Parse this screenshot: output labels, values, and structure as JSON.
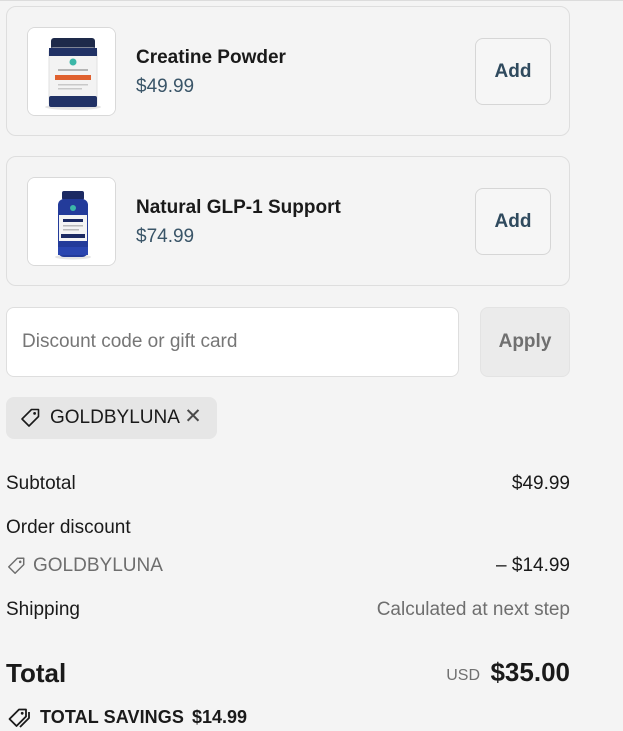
{
  "upsells": [
    {
      "name": "Creatine Powder",
      "price": "$49.99",
      "add_label": "Add",
      "image_icon": "creatine-powder-jar"
    },
    {
      "name": "Natural GLP-1 Support",
      "price": "$74.99",
      "add_label": "Add",
      "image_icon": "glp1-supplement-bottle"
    }
  ],
  "discount": {
    "placeholder": "Discount code or gift card",
    "value": "",
    "apply_label": "Apply",
    "applied_code": "GOLDBYLUNA",
    "remove_icon": "close-icon"
  },
  "summary": {
    "subtotal_label": "Subtotal",
    "subtotal_value": "$49.99",
    "order_discount_label": "Order discount",
    "discount_code": "GOLDBYLUNA",
    "discount_value": "– $14.99",
    "shipping_label": "Shipping",
    "shipping_value": "Calculated at next step",
    "total_label": "Total",
    "currency": "USD",
    "total_value": "$35.00",
    "savings_label": "TOTAL SAVINGS",
    "savings_value": "$14.99"
  },
  "colors": {
    "background": "#f4f4f4",
    "price": "#3a5568",
    "add_text": "#2f4a5e",
    "chip": "#e6e6e6"
  }
}
